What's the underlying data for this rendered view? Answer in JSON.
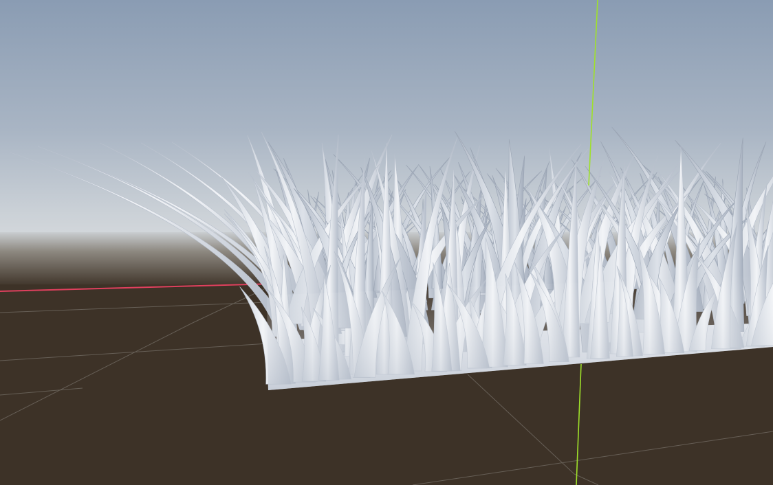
{
  "viewport": {
    "colors": {
      "sky_top": "#8b9db4",
      "sky_mid": "#a6b3c3",
      "horizon_haze": "#cfd4d9",
      "ground": "#3d3227",
      "ground_far": "#4a4036",
      "grid_line": "#6e675f",
      "x_axis": "#e0405e",
      "y_axis": "#9fe12a",
      "grass_light": "#f1f3f6",
      "grass_mid": "#d4d9e1",
      "grass_shadow": "#a9b2c0"
    },
    "icons": {
      "x_axis_line": "x-axis-icon",
      "y_axis_line": "y-axis-icon"
    }
  }
}
